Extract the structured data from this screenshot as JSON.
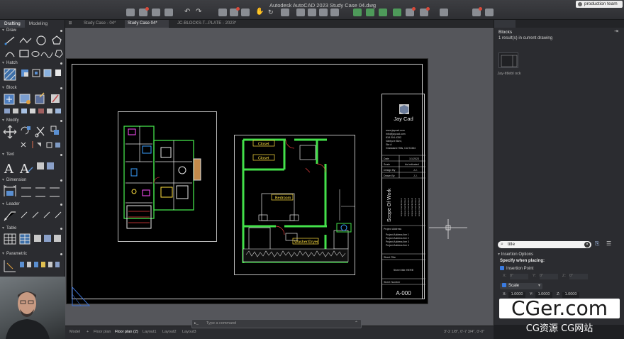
{
  "window": {
    "title": "Autodesk AutoCAD 2023   Study Case 04.dwg"
  },
  "user": {
    "name": "production team"
  },
  "left_panel": {
    "tabs": [
      "Drafting",
      "Modeling"
    ],
    "sections": [
      "Draw",
      "Hatch",
      "Block",
      "Modify",
      "Text",
      "Dimension",
      "Leader",
      "Table",
      "Parametric"
    ]
  },
  "doc_tabs": [
    "Study Case - 04*",
    "Study Case 04*",
    "JC-BLOCKS-T...PLATE - 2023*"
  ],
  "title_block": {
    "logo_text": "Jay Cad",
    "contact_lines": [
      "www.jaycad.com",
      "info@jaycad.com",
      "818.304.4352",
      "Vahtyu'e Blvd,",
      "Ste #",
      "Grassland Hills, CA 91364"
    ],
    "info_rows": [
      {
        "label": "Date",
        "value": "1/1/2023"
      },
      {
        "label": "Scale",
        "value": "As indicated"
      },
      {
        "label": "Design By",
        "value": "J.J."
      },
      {
        "label": "Drawn By",
        "value": "J.J."
      }
    ],
    "scope_title": "Scope Of Work",
    "scope_lines": [
      "scope of works line 1",
      "scope of works line 2",
      "scope of works line 3",
      "scope of works line 4",
      "scope of works line 5",
      "scope of works line 6"
    ],
    "project_address_label": "Project Address",
    "project_address_lines": [
      "Project Address line 1",
      "Project Address line 2",
      "Project Address line 3",
      "Project Address line 4"
    ],
    "sheet_title_label": "Sheet Title",
    "sheet_title_value": "Sheet title HERE",
    "sheet_number_label": "Sheet Number",
    "sheet_number": "A-000"
  },
  "floorplan_labels": {
    "closet1": "Closet",
    "closet2": "Closet",
    "bedroom": "Bedroom",
    "washer": "Washer/Dryer"
  },
  "blocks_panel": {
    "title": "Blocks",
    "result_text": "1 result(s) in current drawing",
    "block_name": "Jay-titlebl ock",
    "search_value": "title",
    "insertion_options_label": "Insertion Options",
    "specify_label": "Specify when placing:",
    "insertion_point_label": "Insertion Point",
    "xyz_labels": [
      "X:",
      "Y:",
      "Z:"
    ],
    "xyz_values": [
      "0\"",
      "0\"",
      "0\""
    ],
    "scale_label": "Scale",
    "scale_labels": [
      "X:",
      "Y:",
      "Z:"
    ],
    "scale_values": [
      "1.0000",
      "1.0000",
      "1.0000"
    ]
  },
  "command_line": {
    "placeholder": "Type a command"
  },
  "layout_tabs": [
    "Model",
    "Floor plan",
    "Floor plan (2)",
    "Layout1",
    "Layout2",
    "Layout3"
  ],
  "status": {
    "coords": "3'-2 1/8\", 0'-7 3/4\", 0'-0\""
  },
  "watermark": {
    "top": "CGer.com",
    "bottom": "CG资源 CG网站"
  }
}
